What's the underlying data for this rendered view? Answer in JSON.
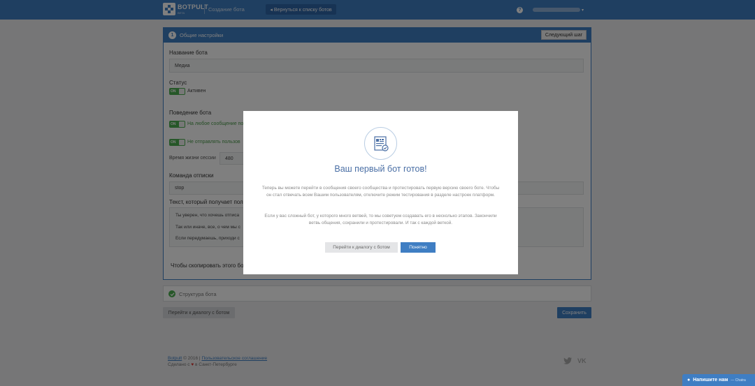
{
  "header": {
    "brand": "BOTPULT",
    "brand_sub": "BETA",
    "page_title": "Создание бота",
    "back_button": "◂ Вернуться к списку ботов",
    "help": "?",
    "caret": "▾"
  },
  "panel": {
    "number": "1",
    "title": "Общие настройки",
    "next_button": "Следующий шаг",
    "bot_name_label": "Название бота",
    "bot_name_value": "Медиа",
    "status_label": "Статус",
    "toggle_on": "ON",
    "status_toggle_label": "Активен",
    "behavior_label": "Поведение бота",
    "behavior_opt1": "На любое сообщение по",
    "behavior_opt2": "Не отправлять пользов",
    "session_label": "Время жизни сессии",
    "session_value": "480",
    "unsub_label": "Команда отписки",
    "unsub_value": "stop",
    "text_label": "Текст, который получает поль",
    "text_lines": [
      "Ты уверен, что хочешь отписа",
      "Так или иначе, все, о чем мы с",
      "Если передумаешь, приходи с"
    ],
    "copy_label": "Чтобы скопировать этого бот"
  },
  "structure": {
    "label": "Структура бота"
  },
  "buttons": {
    "go_dialog": "Перейти к диалогу с ботом",
    "save": "Сохранить"
  },
  "footer": {
    "brand_link": "Botpult",
    "copyright": "© 2016 |",
    "agreement_link": "Пользовательское соглашение",
    "made_prefix": "Сделано с",
    "made_suffix": "в Санкт-Петербурге"
  },
  "chat": {
    "label": "Напишите нам",
    "sub": "— Chatra"
  },
  "modal": {
    "title": "Ваш первый бот готов!",
    "paragraph1": "Теперь вы можете перейти в сообщения своего сообщества и протестировать первую версию своего боте. Чтобы он стал отвечать всем Вашим пользователям, отключите режим тестирования в разделе настроек платформ.",
    "paragraph2": "Если у вас сложный бот, у которого много ветвей, то мы советуем создавать его в несколько этапов. Закончили ветвь общения, сохранили и протестировали. И так с каждой веткой.",
    "button_go": "Перейти к диалогу с ботом",
    "button_ok": "Понятно"
  },
  "colors": {
    "accent": "#3f7ec3",
    "toggle_on": "#4caf50",
    "background": "#ecedef"
  }
}
